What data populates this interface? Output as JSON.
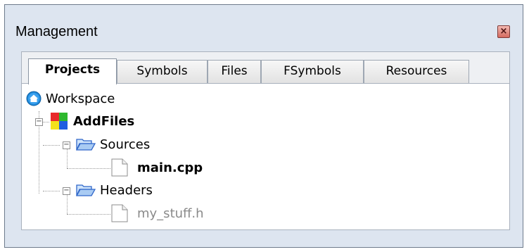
{
  "window": {
    "title": "Management",
    "close_icon": "close-icon"
  },
  "tabs": [
    {
      "label": "Projects",
      "active": true
    },
    {
      "label": "Symbols",
      "active": false
    },
    {
      "label": "Files",
      "active": false
    },
    {
      "label": "FSymbols",
      "active": false
    },
    {
      "label": "Resources",
      "active": false
    }
  ],
  "tree": {
    "workspace": {
      "label": "Workspace",
      "icon": "workspace-icon"
    },
    "project": {
      "label": "AddFiles",
      "icon": "project-icon"
    },
    "folders": [
      {
        "label": "Sources",
        "icon": "folder-open-icon",
        "children": [
          {
            "label": "main.cpp",
            "icon": "file-icon"
          }
        ]
      },
      {
        "label": "Headers",
        "icon": "folder-open-icon",
        "children": [
          {
            "label": "my_stuff.h",
            "icon": "file-icon",
            "dimmed": true
          }
        ]
      }
    ]
  },
  "colors": {
    "panel_bg": "#dde5f0",
    "dimmed_text": "#8a8a8a",
    "workspace_icon": "#1e88d8"
  }
}
